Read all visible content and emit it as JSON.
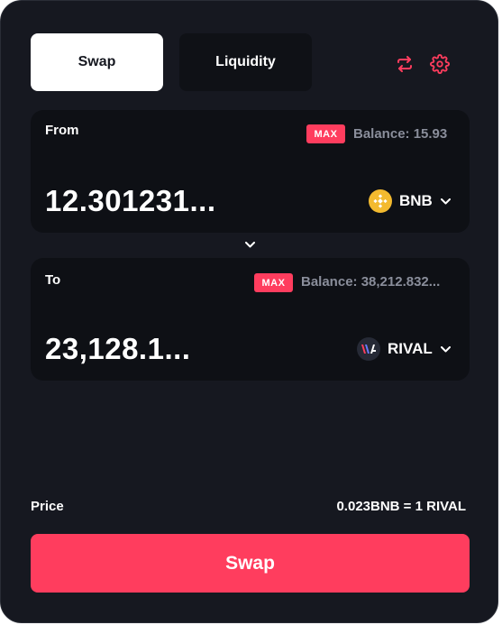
{
  "tabs": [
    {
      "label": "Swap",
      "active": true
    },
    {
      "label": "Liquidity",
      "active": false
    }
  ],
  "header_icons": [
    "refresh-icon",
    "gear-icon"
  ],
  "from": {
    "label": "From",
    "max_label": "MAX",
    "balance": "Balance: 15.93",
    "amount": "12.301231...",
    "token": {
      "symbol": "BNB",
      "icon": "bnb-icon"
    }
  },
  "flip_icon": "chevron-down-icon",
  "to": {
    "label": "To",
    "max_label": "MAX",
    "balance": "Balance: 38,212.832...",
    "amount": "23,128.1...",
    "token": {
      "symbol": "RIVAL",
      "icon": "rival-icon"
    }
  },
  "price": {
    "label": "Price",
    "value": "0.023BNB = 1 RIVAL"
  },
  "swap_button_label": "Swap",
  "colors": {
    "background": "#161820",
    "card": "#0e1015",
    "accent": "#ff3d5e",
    "muted": "#8a8e9b",
    "bnb": "#f3ba2f"
  }
}
